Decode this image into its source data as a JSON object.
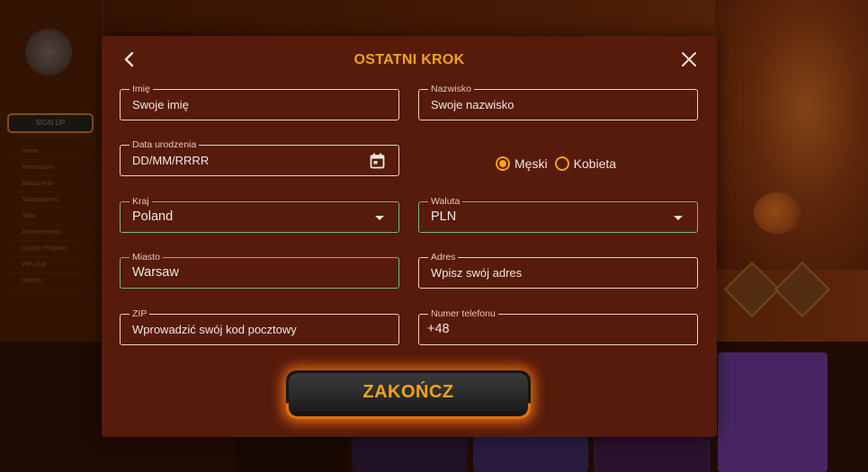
{
  "background": {
    "sidebar": {
      "signup_label": "SIGN UP",
      "menu": [
        "Home",
        "Promotions",
        "Bonus Hub",
        "Tournaments",
        "Shop",
        "Achievements",
        "Loyalty Program",
        "VIP Club",
        "Search"
      ]
    }
  },
  "modal": {
    "title": "OSTATNI KROK",
    "fields": {
      "first_name": {
        "label": "Imię",
        "placeholder": "Swoje imię"
      },
      "last_name": {
        "label": "Nazwisko",
        "placeholder": "Swoje nazwisko"
      },
      "birth_date": {
        "label": "Data urodzenia",
        "placeholder": "DD/MM/RRRR"
      },
      "country": {
        "label": "Kraj",
        "value": "Poland"
      },
      "currency": {
        "label": "Waluta",
        "value": "PLN"
      },
      "city": {
        "label": "Miasto",
        "value": "Warsaw"
      },
      "address": {
        "label": "Adres",
        "placeholder": "Wpisz swój adres"
      },
      "zip": {
        "label": "ZIP",
        "placeholder": "Wprowadzić swój kod pocztowy"
      },
      "phone": {
        "label": "Numer telefonu",
        "value": "+48"
      }
    },
    "gender": {
      "options": [
        "Męski",
        "Kobieta"
      ],
      "selected": "Męski"
    },
    "finish_label": "ZAKOŃCZ"
  },
  "colors": {
    "accent": "#f5a316",
    "modal_bg": "#561b0b",
    "valid_border": "#7cb57a",
    "field_border": "#e9d2c2"
  },
  "icons": {
    "back": "chevron-left-icon",
    "close": "close-icon",
    "calendar": "calendar-icon",
    "dropdown": "chevron-down-icon"
  }
}
